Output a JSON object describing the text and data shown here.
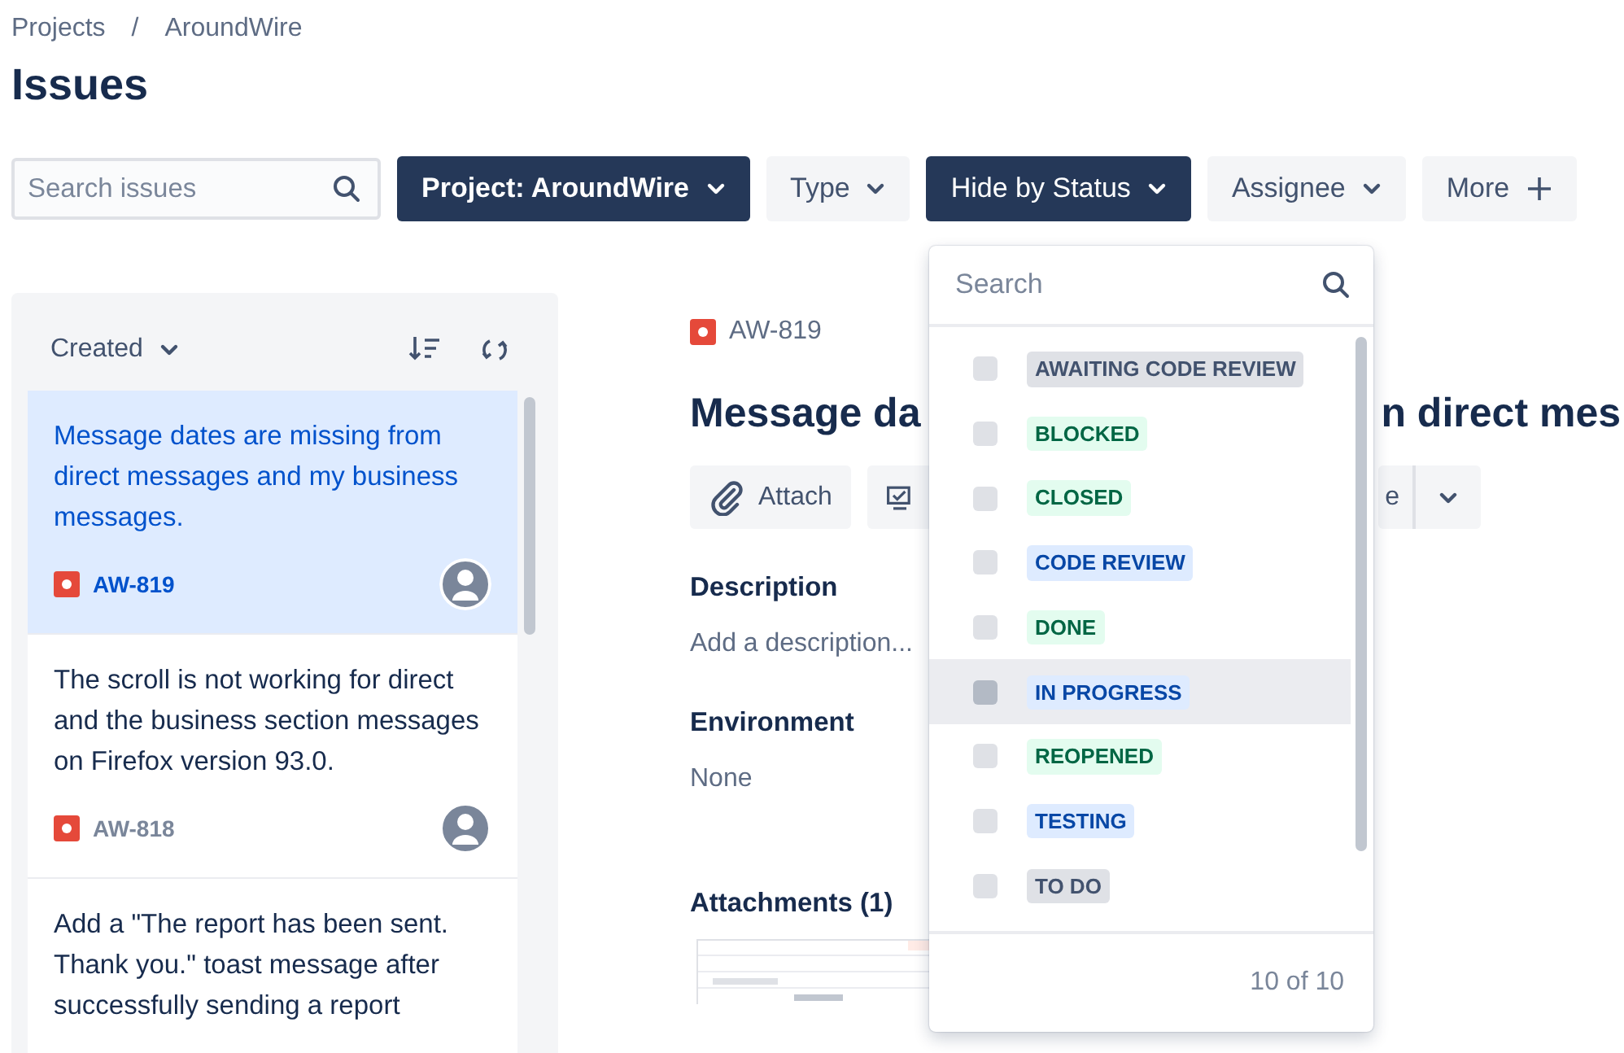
{
  "breadcrumb": [
    "Projects",
    "AroundWire"
  ],
  "breadcrumb_separator": "/",
  "page_title": "Issues",
  "search": {
    "placeholder": "Search issues"
  },
  "filters": [
    {
      "label": "Project: AroundWire",
      "kind": "dropdown",
      "selected": true
    },
    {
      "label": "Type",
      "kind": "dropdown",
      "selected": false
    },
    {
      "label": "Hide by Status",
      "kind": "dropdown",
      "selected": true
    },
    {
      "label": "Assignee",
      "kind": "dropdown",
      "selected": false
    },
    {
      "label": "More",
      "kind": "add",
      "selected": false
    }
  ],
  "issue_list": {
    "sort_label": "Created",
    "issues": [
      {
        "summary": "Message dates are missing from direct messages and my business messages.",
        "key": "AW-819",
        "selected": true
      },
      {
        "summary": "The scroll is not working for direct and the business section messages on Firefox version 93.0.",
        "key": "AW-818",
        "selected": false
      },
      {
        "summary": "Add a \"The report has been sent. Thank you.\" toast message after successfully sending a report",
        "selected": false
      }
    ]
  },
  "detail": {
    "key": "AW-819",
    "title_visible_start": "Message da",
    "title_visible_end": "n direct mes",
    "actions": [
      {
        "kind": "attach",
        "label": "Attach"
      },
      {
        "kind": "checklist"
      },
      {
        "kind": "split",
        "label": "e"
      }
    ],
    "sections": [
      {
        "heading": "Description",
        "text": "Add a description..."
      },
      {
        "heading": "Environment",
        "text": "None"
      }
    ],
    "attachments_heading": "Attachments (1)"
  },
  "status_menu": {
    "placeholder": "Search",
    "count": "10 of 10",
    "statuses": [
      {
        "label": "AWAITING CODE REVIEW",
        "color": "#42526e",
        "checked": false,
        "highlighted": false
      },
      {
        "label": "BLOCKED",
        "color": "#006644",
        "checked": false,
        "highlighted": false
      },
      {
        "label": "CLOSED",
        "color": "#006644",
        "checked": false,
        "highlighted": false
      },
      {
        "label": "CODE REVIEW",
        "color": "#0747a6",
        "checked": false,
        "highlighted": false
      },
      {
        "label": "DONE",
        "color": "#006644",
        "checked": false,
        "highlighted": false
      },
      {
        "label": "IN PROGRESS",
        "color": "#0747a6",
        "checked": false,
        "highlighted": true
      },
      {
        "label": "REOPENED",
        "color": "#006644",
        "checked": false,
        "highlighted": false
      },
      {
        "label": "TESTING",
        "color": "#0747a6",
        "checked": false,
        "highlighted": false
      },
      {
        "label": "TO DO",
        "color": "#42526e",
        "checked": false,
        "highlighted": false
      }
    ]
  }
}
